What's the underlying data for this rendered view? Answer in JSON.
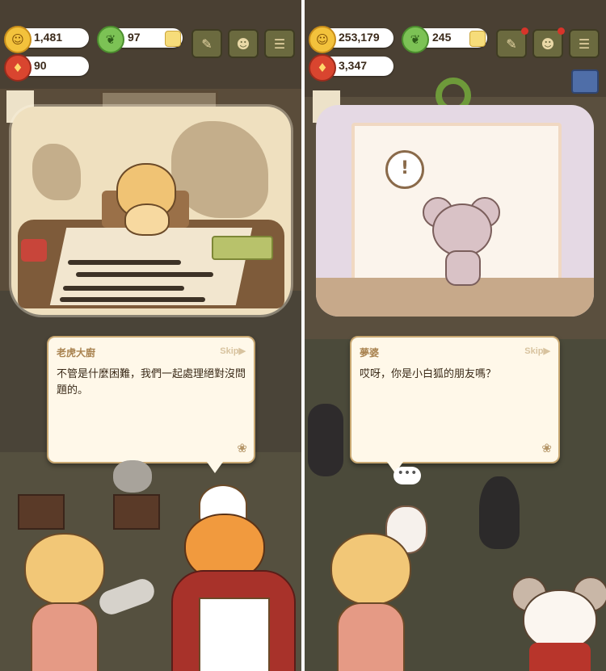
{
  "left": {
    "hud": {
      "coins": "1,481",
      "leaves": "97",
      "pouch": "90"
    },
    "dialog": {
      "speaker": "老虎大廚",
      "skip": "Skip▶",
      "text": "不管是什麼困難，我們一起處理絕對沒問題的。"
    }
  },
  "right": {
    "hud": {
      "coins": "253,179",
      "leaves": "245",
      "pouch": "3,347"
    },
    "dialog": {
      "speaker": "夢婆",
      "skip": "Skip▶",
      "text": "哎呀，你是小白狐的朋友嗎？"
    },
    "typing_bubble": "•••"
  },
  "icons": {
    "coin": "cat-coin-icon",
    "leaf": "leaf-currency-icon",
    "pouch": "red-pouch-icon",
    "plus": "add-currency-icon",
    "paw": "paw-icon"
  },
  "colors": {
    "dialog_bg": "#fff8e9",
    "dialog_border": "#c9a872",
    "hud_btn": "#6b6a3f",
    "notify": "#d8342a"
  }
}
